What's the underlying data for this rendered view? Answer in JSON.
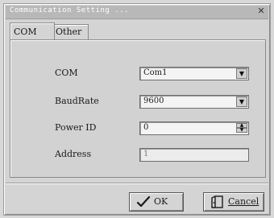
{
  "window": {
    "title": "Communication Setting ...",
    "close_glyph": "✕"
  },
  "tabs": [
    {
      "label": "COM",
      "active": true
    },
    {
      "label": "Other",
      "active": false
    }
  ],
  "form": {
    "com": {
      "label": "COM",
      "value": "Com1"
    },
    "baudrate": {
      "label": "BaudRate",
      "value": "9600"
    },
    "power_id": {
      "label": "Power ID",
      "value": "0"
    },
    "address": {
      "label": "Address",
      "value": "1"
    }
  },
  "buttons": {
    "ok_label": "OK",
    "ok_icon": "checkmark-icon",
    "cancel_label": "Cancel",
    "cancel_icon": "door-exit-icon"
  }
}
